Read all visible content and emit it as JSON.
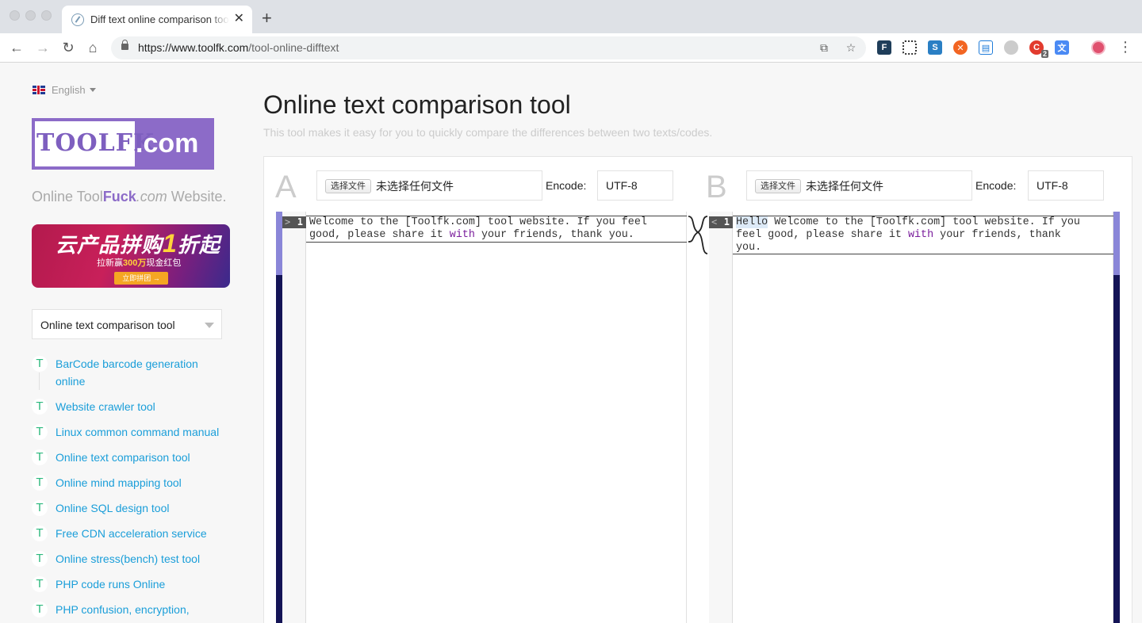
{
  "browser": {
    "tab_title": "Diff text online comparison tool",
    "url_host": "https://www.toolfk.com",
    "url_path": "/tool-online-difftext",
    "extension_badge": "2"
  },
  "sidebar": {
    "language": "English",
    "logo_left": "TOOLFK",
    "logo_right": ".com",
    "tagline_a": "Online Tool",
    "tagline_b": "Fu",
    "tagline_c": "ck",
    "tagline_d": ".com",
    "tagline_e": " Website.",
    "ad": {
      "title_a": "云产品拼购",
      "title_num": "1",
      "title_b": "折起",
      "sub_a": "拉新赢",
      "sub_b": "300万",
      "sub_c": "现金红包",
      "button": "立即拼团 →"
    },
    "tool_select": "Online text comparison tool",
    "menu": [
      {
        "icon": "T",
        "label": "BarCode barcode generation online"
      },
      {
        "icon": "T",
        "label": "Website crawler tool"
      },
      {
        "icon": "T",
        "label": "Linux common command manual"
      },
      {
        "icon": "T",
        "label": "Online text comparison tool"
      },
      {
        "icon": "T",
        "label": "Online mind mapping tool"
      },
      {
        "icon": "T",
        "label": "Online SQL design tool"
      },
      {
        "icon": "T",
        "label": "Free CDN acceleration service"
      },
      {
        "icon": "T",
        "label": "Online stress(bench) test tool"
      },
      {
        "icon": "T",
        "label": "PHP code runs Online"
      },
      {
        "icon": "T",
        "label": "PHP confusion, encryption,"
      }
    ]
  },
  "main": {
    "title": "Online text comparison tool",
    "description": "This tool makes it easy for you to quickly compare the differences between two texts/codes.",
    "side_a": {
      "letter": "A",
      "file_button": "选择文件",
      "file_status": "未选择任何文件",
      "encode_label": "Encode:",
      "encode_value": "UTF-8",
      "line_marker": ">",
      "line_number": "1",
      "text_1": "Welcome to the [Toolfk.com] tool website. If you feel\ngood, please share it ",
      "text_kw": "with",
      "text_2": " your friends, thank you."
    },
    "side_b": {
      "letter": "B",
      "file_button": "选择文件",
      "file_status": "未选择任何文件",
      "encode_label": "Encode:",
      "encode_value": "UTF-8",
      "line_marker": "<",
      "line_number": "1",
      "text_added": "Hello",
      "text_1": " Welcome to the [Toolfk.com] tool website. If you\nfeel good, please share it ",
      "text_kw": "with",
      "text_2": " your friends, thank\nyou."
    }
  }
}
